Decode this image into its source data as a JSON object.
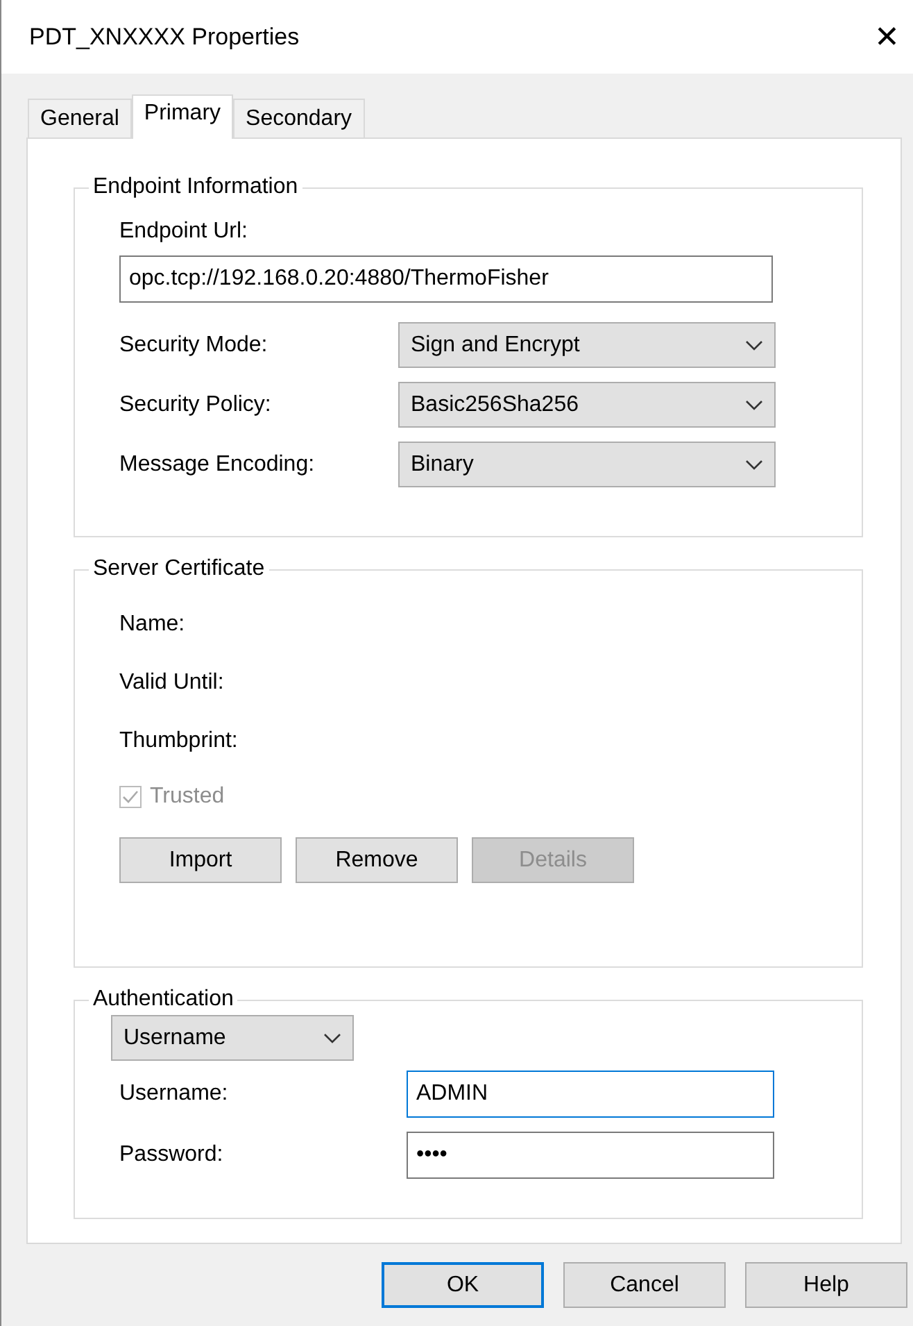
{
  "window": {
    "title": "PDT_XNXXXX Properties",
    "close": "✕"
  },
  "tabs": [
    {
      "label": "General",
      "selected": false
    },
    {
      "label": "Primary",
      "selected": true
    },
    {
      "label": "Secondary",
      "selected": false
    }
  ],
  "endpoint_information": {
    "title": "Endpoint Information",
    "url_label": "Endpoint Url:",
    "url_value": "opc.tcp://192.168.0.20:4880/ThermoFisher",
    "dropdowns": [
      {
        "label": "Security Mode:",
        "value": "Sign and Encrypt"
      },
      {
        "label": "Security Policy:",
        "value": "Basic256Sha256"
      },
      {
        "label": "Message Encoding:",
        "value": "Binary"
      }
    ]
  },
  "server_certificate": {
    "title": "Server Certificate",
    "fields": [
      "Name:",
      "Valid Until:",
      "Thumbprint:"
    ],
    "trusted": {
      "label": "Trusted",
      "checked": true,
      "disabled": true
    },
    "buttons": [
      {
        "label": "Import",
        "disabled": false
      },
      {
        "label": "Remove",
        "disabled": false
      },
      {
        "label": "Details",
        "disabled": true
      }
    ]
  },
  "authentication": {
    "title": "Authentication",
    "mode": "Username",
    "fields": [
      {
        "label": "Username:",
        "value": "ADMIN",
        "focused": true
      },
      {
        "label": "Password:",
        "value": "••••",
        "focused": false
      }
    ]
  },
  "buttons": [
    {
      "label": "OK",
      "default": true
    },
    {
      "label": "Cancel",
      "default": false
    },
    {
      "label": "Help",
      "default": false
    }
  ]
}
